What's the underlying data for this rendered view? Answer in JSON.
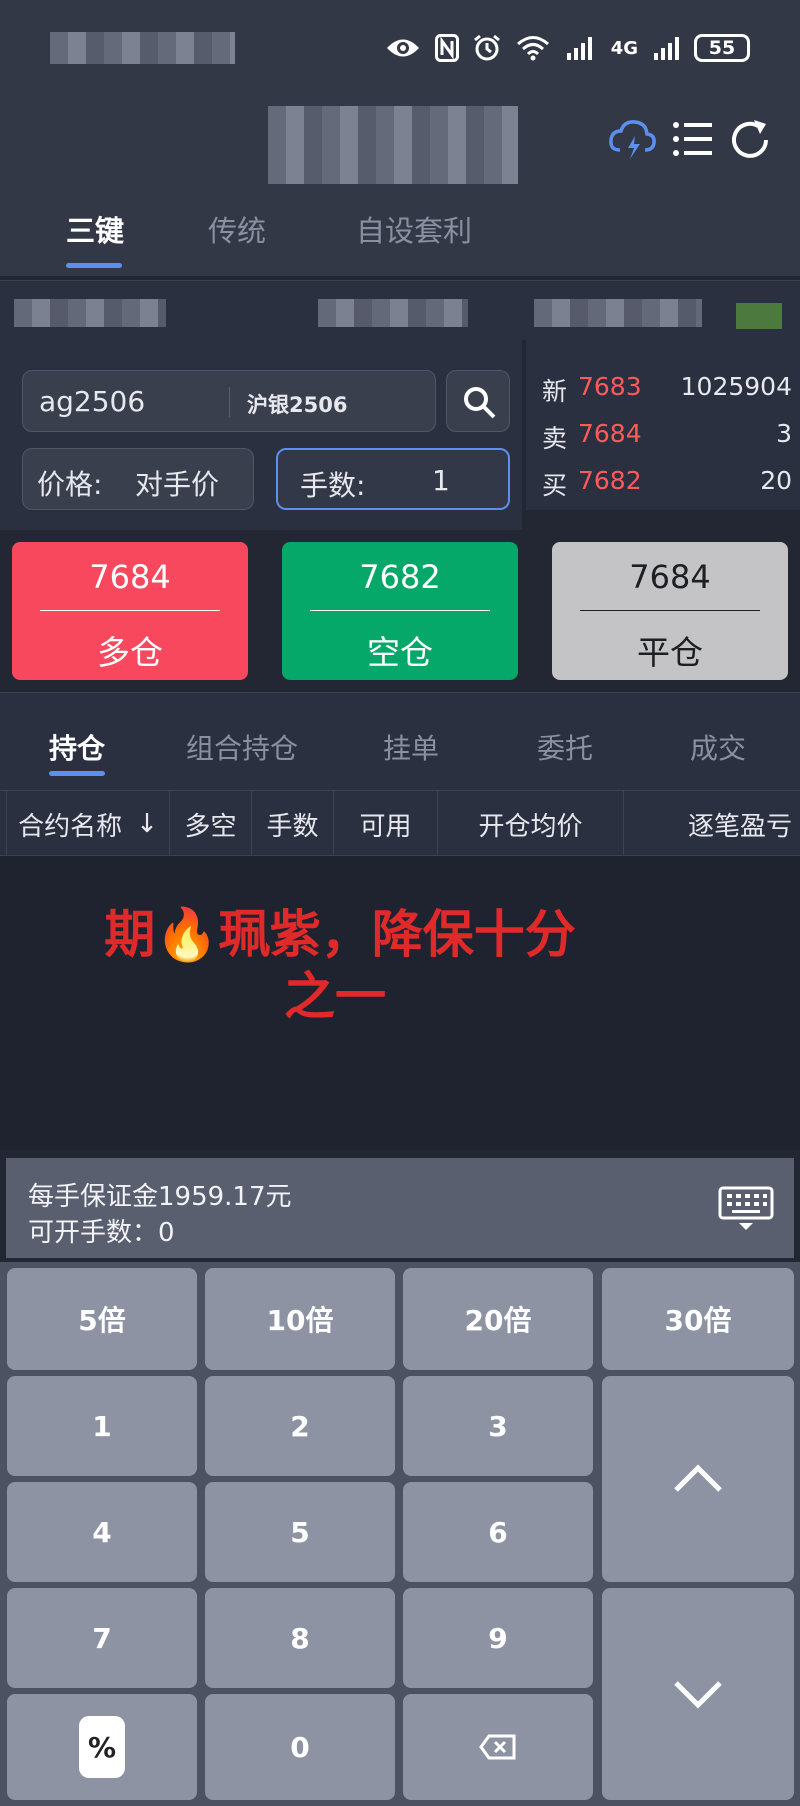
{
  "status_bar": {
    "battery": "55",
    "network": "4G",
    "icons": [
      "eye-icon",
      "nfc-icon",
      "alarm-icon",
      "wifi-icon",
      "signal-icon",
      "battery-icon"
    ]
  },
  "header": {
    "actions": [
      "cloud-lightning-icon",
      "list-icon",
      "refresh-icon"
    ]
  },
  "top_tabs": [
    {
      "label": "三键",
      "active": true
    },
    {
      "label": "传统",
      "active": false
    },
    {
      "label": "自设套利",
      "active": false
    }
  ],
  "order": {
    "contract_code": "ag2506",
    "contract_name": "沪银2506",
    "price_label": "价格:",
    "price_value": "对手价",
    "qty_label": "手数:",
    "qty_value": "1"
  },
  "quote": {
    "last": {
      "label": "新",
      "price": "7683",
      "value": "1025904"
    },
    "ask": {
      "label": "卖",
      "price": "7684",
      "value": "3"
    },
    "bid": {
      "label": "买",
      "price": "7682",
      "value": "20"
    }
  },
  "trade_buttons": {
    "long": {
      "price": "7684",
      "label": "多仓"
    },
    "short": {
      "price": "7682",
      "label": "空仓"
    },
    "close": {
      "price": "7684",
      "label": "平仓"
    }
  },
  "position_tabs": [
    {
      "label": "持仓",
      "active": true
    },
    {
      "label": "组合持仓",
      "active": false
    },
    {
      "label": "挂单",
      "active": false
    },
    {
      "label": "委托",
      "active": false
    },
    {
      "label": "成交",
      "active": false
    }
  ],
  "columns": [
    "合约名称",
    "多空",
    "手数",
    "可用",
    "开仓均价",
    "逐笔盈亏"
  ],
  "sort_arrow": "↓",
  "overlay_text": {
    "line1": "期",
    "emoji": "🔥",
    "line1_rest": "珮紫，降保十分",
    "line2": "之一"
  },
  "keyboard_info": {
    "margin": "每手保证金1959.17元",
    "available": "可开手数：0"
  },
  "keyboard": {
    "row1": [
      "5倍",
      "10倍",
      "20倍",
      "30倍"
    ],
    "digits": [
      "1",
      "2",
      "3",
      "4",
      "5",
      "6",
      "7",
      "8",
      "9"
    ],
    "percent": "%",
    "zero": "0"
  },
  "colors": {
    "long": "#f8485e",
    "short": "#06a86a",
    "close": "#c4c4c6",
    "accent": "#5b8ff0",
    "price_red": "#ff5a5a",
    "overlay_red": "#e02a2a"
  }
}
